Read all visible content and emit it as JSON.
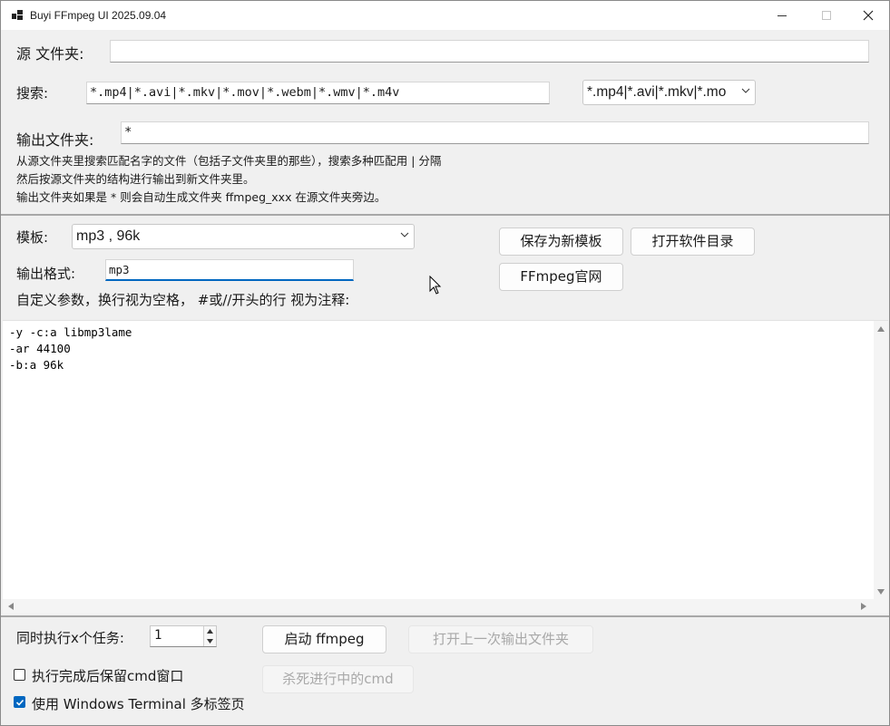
{
  "window": {
    "title": "Buyi FFmpeg UI 2025.09.04"
  },
  "source": {
    "label": "源 文件夹:",
    "value": ""
  },
  "search": {
    "label": "搜索:",
    "value": "*.mp4|*.avi|*.mkv|*.mov|*.webm|*.wmv|*.m4v",
    "preset": "*.mp4|*.avi|*.mkv|*.mo"
  },
  "output": {
    "label": "输出文件夹:",
    "value": "*"
  },
  "help": {
    "line1": "从源文件夹里搜索匹配名字的文件（包括子文件夹里的那些），搜索多种匹配用 | 分隔",
    "line2": "然后按源文件夹的结构进行输出到新文件夹里。",
    "line3": "输出文件夹如果是 * 则会自动生成文件夹 ffmpeg_xxx 在源文件夹旁边。"
  },
  "template": {
    "label": "模板:",
    "value": "mp3 , 96k"
  },
  "buttons": {
    "save_template": "保存为新模板",
    "open_app_dir": "打开软件目录",
    "ffmpeg_site": "FFmpeg官网",
    "start": "启动 ffmpeg",
    "open_last_output": "打开上一次输出文件夹",
    "kill_cmd": "杀死进行中的cmd"
  },
  "format": {
    "label": "输出格式:",
    "value": "mp3"
  },
  "params": {
    "label": "自定义参数，换行视为空格， #或//开头的行 视为注释:",
    "text": "-y -c:a libmp3lame\n-ar 44100\n-b:a 96k"
  },
  "tasks": {
    "label": "同时执行x个任务:",
    "value": "1"
  },
  "options": {
    "keep_cmd": {
      "label": "执行完成后保留cmd窗口",
      "checked": false
    },
    "windows_terminal": {
      "label": "使用 Windows Terminal 多标签页",
      "checked": true
    }
  },
  "colors": {
    "accent": "#0067c0",
    "separator": "#a8a8a8",
    "disabled_text": "#a8a8a8"
  }
}
